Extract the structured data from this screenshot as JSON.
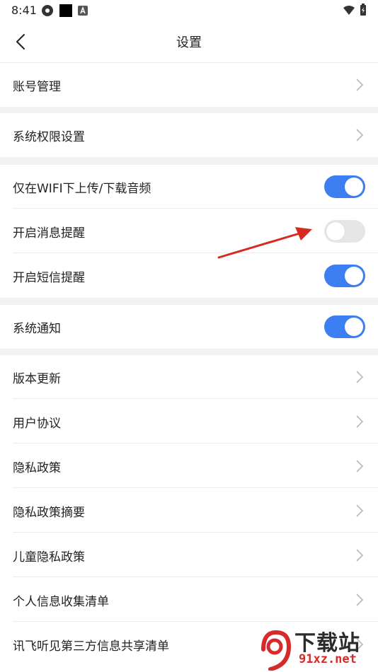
{
  "status": {
    "time": "8:41"
  },
  "nav": {
    "title": "设置"
  },
  "rows": {
    "account": "账号管理",
    "permissions": "系统权限设置",
    "wifi_only": "仅在WIFI下上传/下载音频",
    "message_reminder": "开启消息提醒",
    "sms_reminder": "开启短信提醒",
    "system_notify": "系统通知",
    "version_update": "版本更新",
    "user_agreement": "用户协议",
    "privacy_policy": "隐私政策",
    "privacy_summary": "隐私政策摘要",
    "child_privacy": "儿童隐私政策",
    "personal_info_list": "个人信息收集清单",
    "third_party_list": "讯飞听见第三方信息共享清单"
  },
  "toggles": {
    "wifi_only": true,
    "message_reminder": false,
    "sms_reminder": true,
    "system_notify": true
  },
  "colors": {
    "accent": "#3d7ef2",
    "annotation_arrow": "#d42a22"
  },
  "watermark": {
    "main": "下载站",
    "sub": "91xz.net"
  }
}
